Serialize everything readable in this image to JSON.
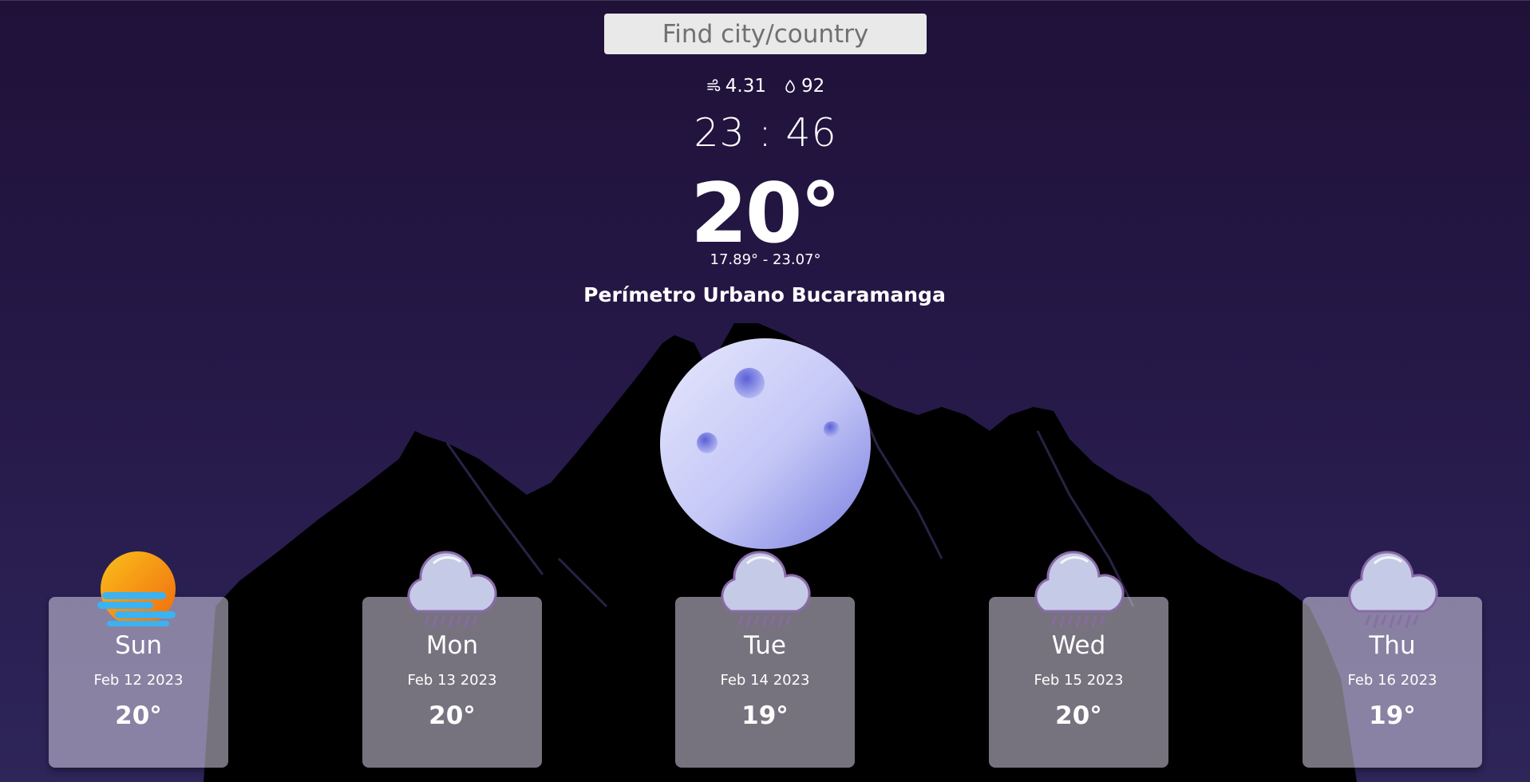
{
  "search": {
    "placeholder": "Find city/country"
  },
  "current": {
    "wind": "4.31",
    "humidity": "92",
    "time": "23 : 46",
    "temperature": "20°",
    "range": "17.89° - 23.07°",
    "city": "Perímetro Urbano Bucaramanga",
    "icon": "moon-icon"
  },
  "forecast": [
    {
      "day": "Sun",
      "date": "Feb 12 2023",
      "temp": "20°",
      "icon": "sunset-icon"
    },
    {
      "day": "Mon",
      "date": "Feb 13 2023",
      "temp": "20°",
      "icon": "rain-cloud-icon"
    },
    {
      "day": "Tue",
      "date": "Feb 14 2023",
      "temp": "19°",
      "icon": "rain-cloud-icon"
    },
    {
      "day": "Wed",
      "date": "Feb 15 2023",
      "temp": "20°",
      "icon": "rain-cloud-icon"
    },
    {
      "day": "Thu",
      "date": "Feb 16 2023",
      "temp": "19°",
      "icon": "rain-cloud-icon"
    }
  ],
  "colors": {
    "background_top": "#1f1138",
    "background_bottom": "#2e2559",
    "moon": "#c9cbf7",
    "card": "#d2cde1",
    "mountain": "#000000"
  }
}
